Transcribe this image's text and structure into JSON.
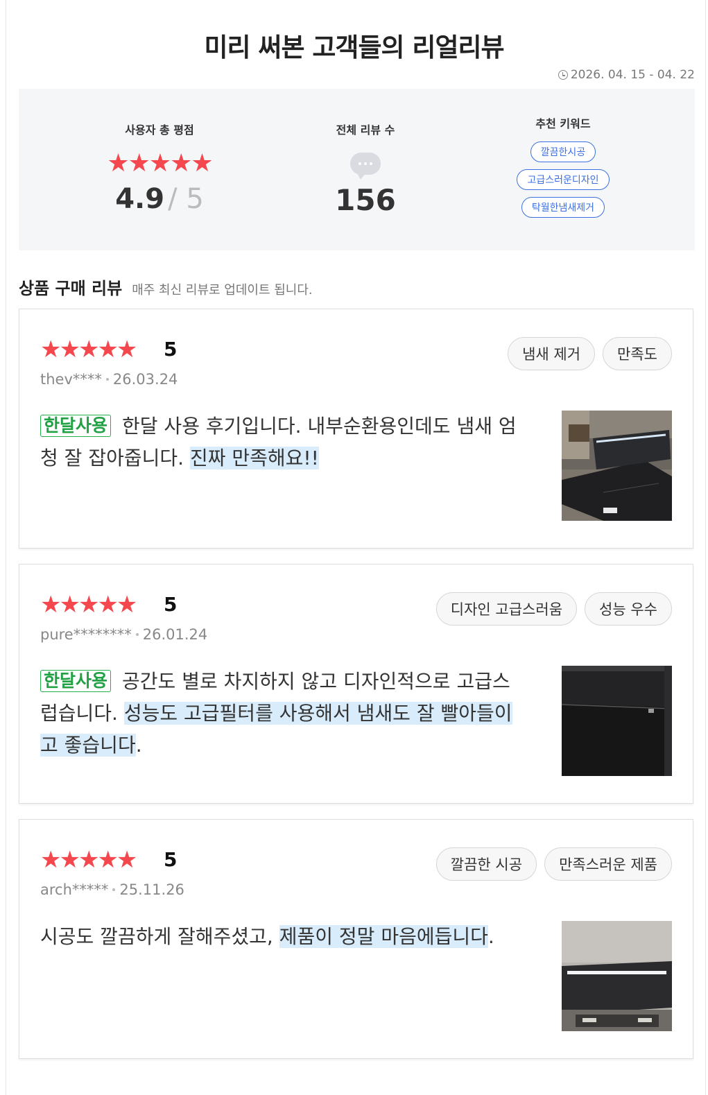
{
  "title": "미리 써본 고객들의 리얼리뷰",
  "period": "2026. 04. 15 - 04. 22",
  "summary": {
    "rating_label": "사용자 총 평점",
    "stars": "★★★★★",
    "rating": "4.9",
    "rating_max": "/ 5",
    "count_label": "전체 리뷰 수",
    "count": "156",
    "keywords_label": "추천 키워드",
    "keywords": [
      "깔끔한시공",
      "고급스러운디자인",
      "탁월한냄새제거"
    ]
  },
  "section": {
    "heading": "상품 구매 리뷰",
    "sub": "매주 최신 리뷰로 업데이트 됩니다."
  },
  "reviews": [
    {
      "stars": "★★★★★",
      "rating": "5",
      "user": "thev****",
      "date": "26.03.24",
      "tags": [
        "냄새 제거",
        "만족도"
      ],
      "badge": "한달사용",
      "text": "한달 사용 후기입니다. 내부순환용인데도 냄새 엄청 잘 잡아줍니다. ",
      "highlight": "진짜 만족해요!!",
      "text_after": ""
    },
    {
      "stars": "★★★★★",
      "rating": "5",
      "user": "pure********",
      "date": "26.01.24",
      "tags": [
        "디자인 고급스러움",
        "성능 우수"
      ],
      "badge": "한달사용",
      "text": "공간도 별로 차지하지 않고 디자인적으로 고급스럽습니다. ",
      "highlight": "성능도 고급필터를 사용해서 냄새도 잘 빨아들이고 좋습니다",
      "text_after": "."
    },
    {
      "stars": "★★★★★",
      "rating": "5",
      "user": "arch*****",
      "date": "25.11.26",
      "tags": [
        "깔끔한 시공",
        "만족스러운 제품"
      ],
      "badge": "",
      "text": "시공도 깔끔하게 잘해주셨고, ",
      "highlight": "제품이 정말 마음에듭니다",
      "text_after": "."
    }
  ]
}
